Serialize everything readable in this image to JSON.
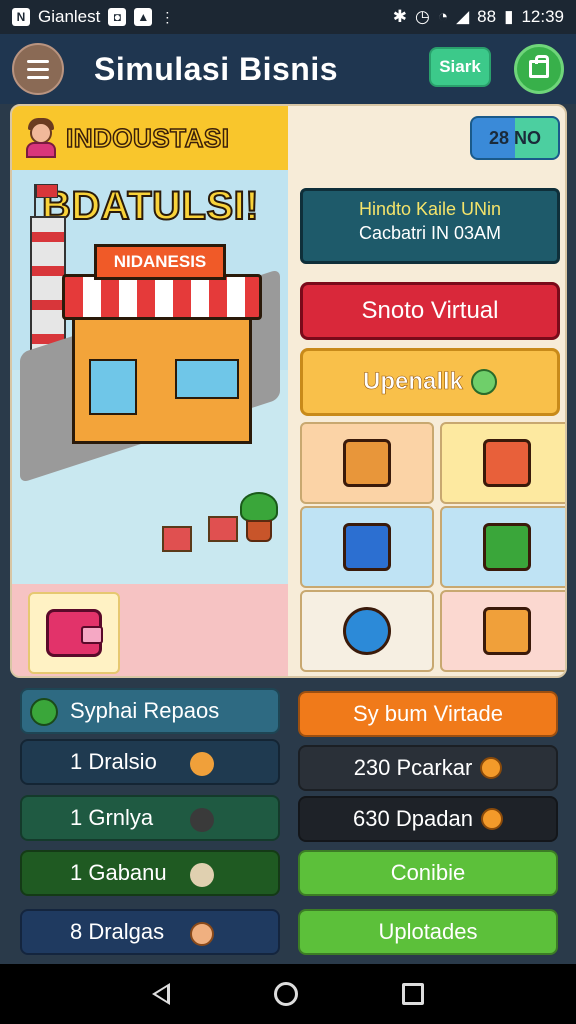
{
  "status_bar": {
    "app_name": "Gianlest",
    "battery": "88",
    "time": "12:39"
  },
  "header": {
    "title": "Simulasi Bisnis",
    "start_label": "Siark"
  },
  "panel": {
    "industry_label": "INDOUSTASI",
    "scene_label": "BDATULSI!",
    "store_sign": "NIDANESIS",
    "counter_label": "28 NO",
    "info_line1": "Hindto Kaile UNin",
    "info_line2": "Cacbatri IN 03AM",
    "virtual_label": "Snoto Virtual",
    "upgrade_label": "Upenallk"
  },
  "rows": {
    "left": [
      {
        "label": "Syphai Repaos"
      },
      {
        "label": "1 Dralsio"
      },
      {
        "label": "1 Grnlya"
      },
      {
        "label": "1 Gabanu"
      },
      {
        "label": "8 Dralgas"
      }
    ],
    "right": [
      {
        "label": "Sy bum Virtade"
      },
      {
        "label": "230 Pcarkar"
      },
      {
        "label": "630 Dpadan"
      },
      {
        "label": "Conibie"
      },
      {
        "label": "Uplotades"
      }
    ]
  },
  "colors": {
    "header_bg": "#1f3650",
    "accent_green": "#38b04a",
    "accent_red": "#d9283a",
    "accent_orange": "#f07a1a"
  }
}
